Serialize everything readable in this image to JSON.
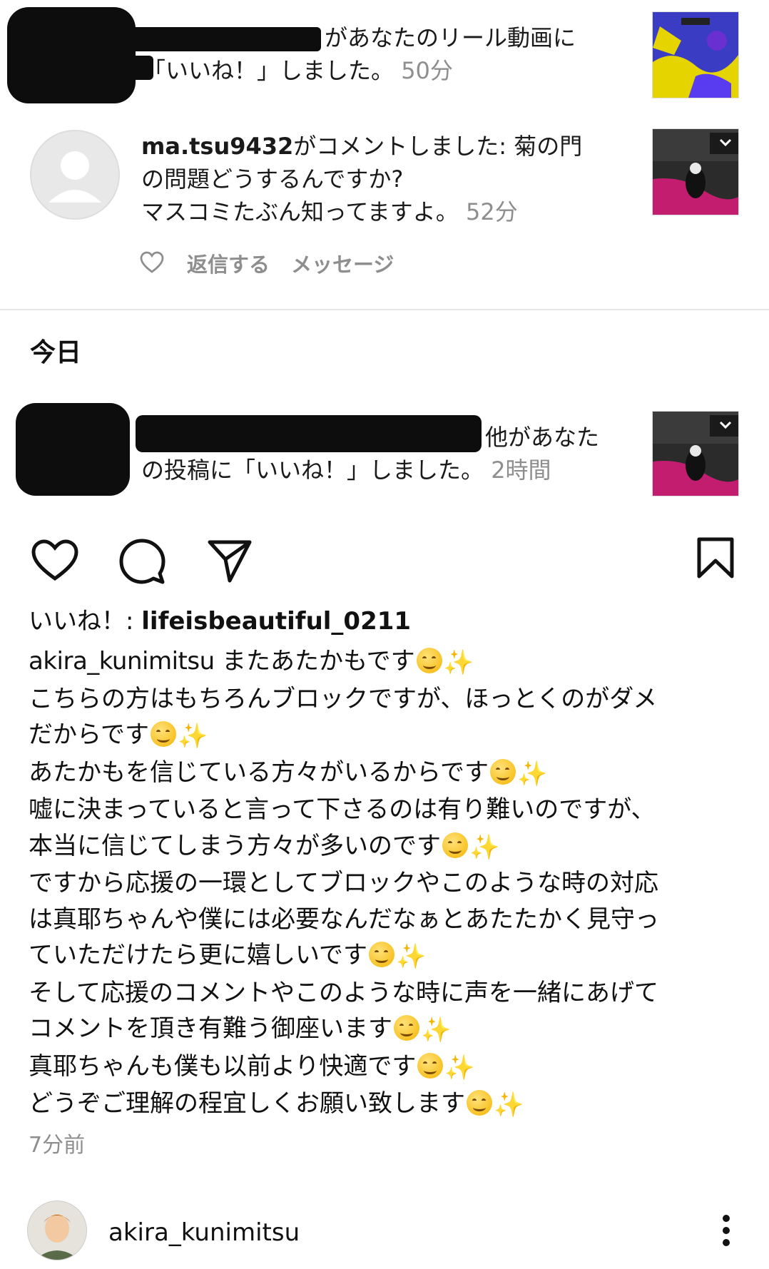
{
  "notifications": [
    {
      "text_line1": "があなたのリール動画に",
      "text_line2": "「いいね！」しました。",
      "time": "50分"
    },
    {
      "username": "ma.tsu9432",
      "text_line1_suffix": "がコメントしました: 菊の門",
      "text_line2": "の問題どうするんですか?",
      "text_line3": "マスコミたぶん知ってますよ。",
      "time": "52分",
      "reply_label": "返信する",
      "message_label": "メッセージ"
    }
  ],
  "section_today": "今日",
  "today_notification": {
    "text_line1": "他があなた",
    "text_line2": "の投稿に「いいね！」しました。",
    "time": "2時間"
  },
  "post": {
    "likes_prefix": "いいね！: ",
    "likes_user": "lifeisbeautiful_0211",
    "author": "akira_kunimitsu",
    "caption_lines": [
      {
        "text": "またあたかもです",
        "emoji": true
      },
      {
        "text": "こちらの方はもちろんブロックですが、ほっとくのがダメ",
        "emoji": false
      },
      {
        "text": "だからです",
        "emoji": true
      },
      {
        "text": "あたかもを信じている方々がいるからです",
        "emoji": true
      },
      {
        "text": "嘘に決まっていると言って下さるのは有り難いのですが、",
        "emoji": false
      },
      {
        "text": "本当に信じてしまう方々が多いのです",
        "emoji": true
      },
      {
        "text": "ですから応援の一環としてブロックやこのような時の対応",
        "emoji": false
      },
      {
        "text": "は真耶ちゃんや僕には必要なんだなぁとあたたかく見守っ",
        "emoji": false
      },
      {
        "text": "ていただけたら更に嬉しいです",
        "emoji": true
      },
      {
        "text": "そして応援のコメントやこのような時に声を一緒にあげて",
        "emoji": false
      },
      {
        "text": "コメントを頂き有難う御座います",
        "emoji": true
      },
      {
        "text": "真耶ちゃんも僕も以前より快適です",
        "emoji": true
      },
      {
        "text": "どうぞご理解の程宜しくお願い致します",
        "emoji": true
      }
    ],
    "time": "7分前",
    "footer_user": "akira_kunimitsu"
  },
  "icons": {
    "like": "heart-icon",
    "comment": "comment-icon",
    "share": "send-icon",
    "save": "bookmark-icon",
    "more": "more-vertical-icon"
  }
}
